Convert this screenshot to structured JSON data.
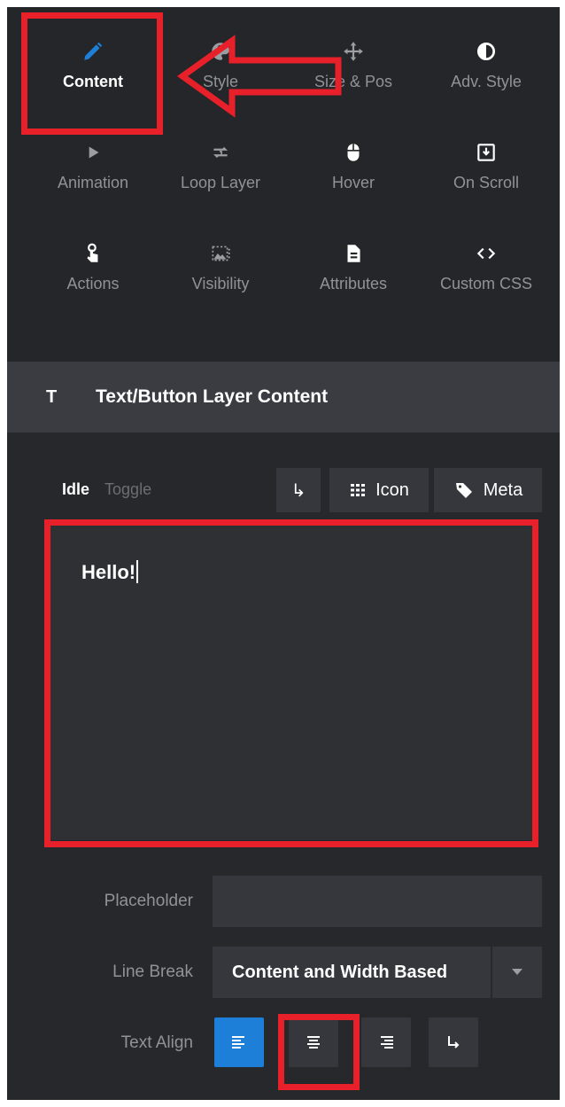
{
  "tools": [
    {
      "label": "Content",
      "icon": "pencil-icon",
      "active": true
    },
    {
      "label": "Style",
      "icon": "palette-icon",
      "active": false
    },
    {
      "label": "Size & Pos",
      "icon": "move-arrows-icon",
      "active": false
    },
    {
      "label": "Adv. Style",
      "icon": "contrast-icon",
      "active": false
    },
    {
      "label": "Animation",
      "icon": "play-icon",
      "active": false
    },
    {
      "label": "Loop Layer",
      "icon": "loop-icon",
      "active": false
    },
    {
      "label": "Hover",
      "icon": "mouse-icon",
      "active": false
    },
    {
      "label": "On Scroll",
      "icon": "scroll-download-icon",
      "active": false
    },
    {
      "label": "Actions",
      "icon": "pointer-hand-icon",
      "active": false
    },
    {
      "label": "Visibility",
      "icon": "image-visibility-icon",
      "active": false
    },
    {
      "label": "Attributes",
      "icon": "document-icon",
      "active": false
    },
    {
      "label": "Custom CSS",
      "icon": "code-icon",
      "active": false
    }
  ],
  "section": {
    "icon_text": "T",
    "title": "Text/Button Layer Content"
  },
  "state_tabs": {
    "idle": "Idle",
    "toggle": "Toggle"
  },
  "toolbar": {
    "return_label": "↳",
    "icon_label": "Icon",
    "meta_label": "Meta"
  },
  "editor": {
    "text": "Hello!"
  },
  "fields": {
    "placeholder_label": "Placeholder",
    "placeholder_value": "",
    "line_break_label": "Line Break",
    "line_break_value": "Content and Width Based",
    "text_align_label": "Text Align"
  },
  "text_align": {
    "selected": "left",
    "options": [
      "left",
      "center",
      "right",
      "reset"
    ]
  },
  "colors": {
    "accent": "#1e7fd8",
    "highlight": "#e8202a",
    "panel": "#252629",
    "header": "#3a3c42"
  }
}
